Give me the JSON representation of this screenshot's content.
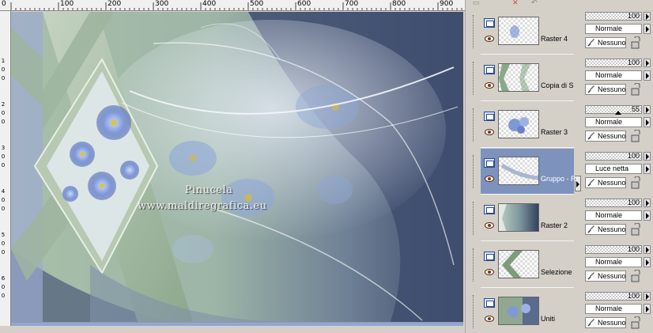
{
  "ruler": {
    "top_labels": [
      "0",
      "100",
      "200",
      "300",
      "400",
      "500",
      "600",
      "700",
      "800",
      "900"
    ],
    "left_labels": [
      "1",
      "0",
      "0",
      "2",
      "0",
      "0",
      "3",
      "0",
      "0",
      "4",
      "0",
      "0",
      "5",
      "0",
      "0",
      "6",
      "0",
      "0"
    ]
  },
  "canvas": {
    "watermark_line1": "Pinucela",
    "watermark_line2": "www.maldiregrafica.eu",
    "colors": {
      "dark_blue": "#3c4a6a",
      "sage_green": "#8aa88a",
      "flower_blue": "#7f98d6"
    }
  },
  "toolbar": {
    "delete_icon": "close-icon",
    "undo_icon": "undo-icon"
  },
  "layers": [
    {
      "name": "Raster 4",
      "opacity": "100",
      "blend": "Normale",
      "mask": "Nessuno",
      "selected": false,
      "thumb": "raster4"
    },
    {
      "name": "Copia di S",
      "opacity": "100",
      "blend": "Normale",
      "mask": "Nessuno",
      "selected": false,
      "thumb": "copia"
    },
    {
      "name": "Raster 3",
      "opacity": "55",
      "blend": "Normale",
      "mask": "Nessuno",
      "selected": false,
      "thumb": "raster3"
    },
    {
      "name": "Gruppo - R",
      "opacity": "100",
      "blend": "Luce netta",
      "mask": "Nessuno",
      "selected": true,
      "thumb": "gruppo"
    },
    {
      "name": "Raster 2",
      "opacity": "100",
      "blend": "Normale",
      "mask": "Nessuno",
      "selected": false,
      "thumb": "raster2"
    },
    {
      "name": "Selezione",
      "opacity": "100",
      "blend": "Normale",
      "mask": "Nessuno",
      "selected": false,
      "thumb": "selezione"
    },
    {
      "name": "Uniti",
      "opacity": "100",
      "blend": "Normale",
      "mask": "Nessuno",
      "selected": false,
      "thumb": "uniti"
    }
  ]
}
